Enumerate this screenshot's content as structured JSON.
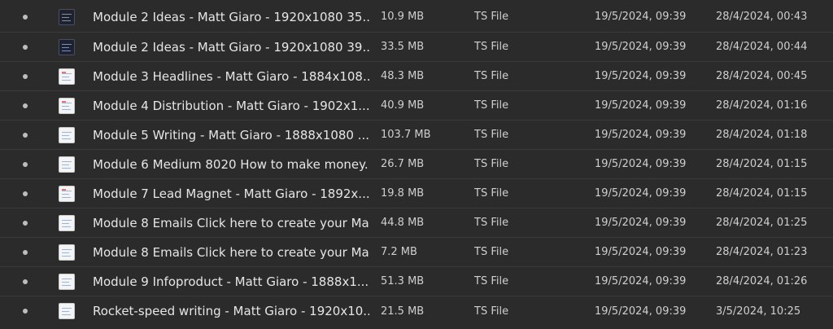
{
  "files": [
    {
      "name": "Module 2 Ideas - Matt Giaro - 1920x1080 35...",
      "size": "10.9 MB",
      "type": "TS File",
      "date_modified": "19/5/2024, 09:39",
      "date_created": "28/4/2024, 00:43",
      "thumb": "dark",
      "icon": "video-thumbnail-icon"
    },
    {
      "name": "Module 2 Ideas - Matt Giaro - 1920x1080 39...",
      "size": "33.5 MB",
      "type": "TS File",
      "date_modified": "19/5/2024, 09:39",
      "date_created": "28/4/2024, 00:44",
      "thumb": "dark",
      "icon": "video-thumbnail-icon"
    },
    {
      "name": "Module 3 Headlines - Matt Giaro - 1884x108...",
      "size": "48.3 MB",
      "type": "TS File",
      "date_modified": "19/5/2024, 09:39",
      "date_created": "28/4/2024, 00:45",
      "thumb": "light",
      "icon": "video-thumbnail-icon"
    },
    {
      "name": "Module 4 Distribution - Matt Giaro - 1902x1...",
      "size": "40.9 MB",
      "type": "TS File",
      "date_modified": "19/5/2024, 09:39",
      "date_created": "28/4/2024, 01:16",
      "thumb": "light",
      "icon": "video-thumbnail-icon"
    },
    {
      "name": "Module 5 Writing - Matt Giaro - 1888x1080 ...",
      "size": "103.7 MB",
      "type": "TS File",
      "date_modified": "19/5/2024, 09:39",
      "date_created": "28/4/2024, 01:18",
      "thumb": "light",
      "icon": "video-thumbnail-icon"
    },
    {
      "name": "Module 6 Medium 8020 How to make money...",
      "size": "26.7 MB",
      "type": "TS File",
      "date_modified": "19/5/2024, 09:39",
      "date_created": "28/4/2024, 01:15",
      "thumb": "light",
      "icon": "video-thumbnail-icon"
    },
    {
      "name": "Module 7 Lead Magnet - Matt Giaro - 1892x...",
      "size": "19.8 MB",
      "type": "TS File",
      "date_modified": "19/5/2024, 09:39",
      "date_created": "28/4/2024, 01:15",
      "thumb": "light",
      "icon": "video-thumbnail-icon"
    },
    {
      "name": "Module 8 Emails Click here to create your Ma...",
      "size": "44.8 MB",
      "type": "TS File",
      "date_modified": "19/5/2024, 09:39",
      "date_created": "28/4/2024, 01:25",
      "thumb": "light",
      "icon": "video-thumbnail-icon"
    },
    {
      "name": "Module 8 Emails Click here to create your Ma...",
      "size": "7.2 MB",
      "type": "TS File",
      "date_modified": "19/5/2024, 09:39",
      "date_created": "28/4/2024, 01:23",
      "thumb": "light",
      "icon": "video-thumbnail-icon"
    },
    {
      "name": "Module 9 Infoproduct - Matt Giaro - 1888x1...",
      "size": "51.3 MB",
      "type": "TS File",
      "date_modified": "19/5/2024, 09:39",
      "date_created": "28/4/2024, 01:26",
      "thumb": "light",
      "icon": "video-thumbnail-icon"
    },
    {
      "name": "Rocket-speed writing - Matt Giaro - 1920x10...",
      "size": "21.5 MB",
      "type": "TS File",
      "date_modified": "19/5/2024, 09:39",
      "date_created": "3/5/2024, 10:25",
      "thumb": "light",
      "icon": "video-thumbnail-icon"
    }
  ],
  "colors": {
    "background": "#2b2b2b",
    "row_divider": "#3a3a3a",
    "text_primary": "#e6e6e6",
    "text_secondary": "#cfcfcf",
    "bullet": "#bdbdbd"
  }
}
